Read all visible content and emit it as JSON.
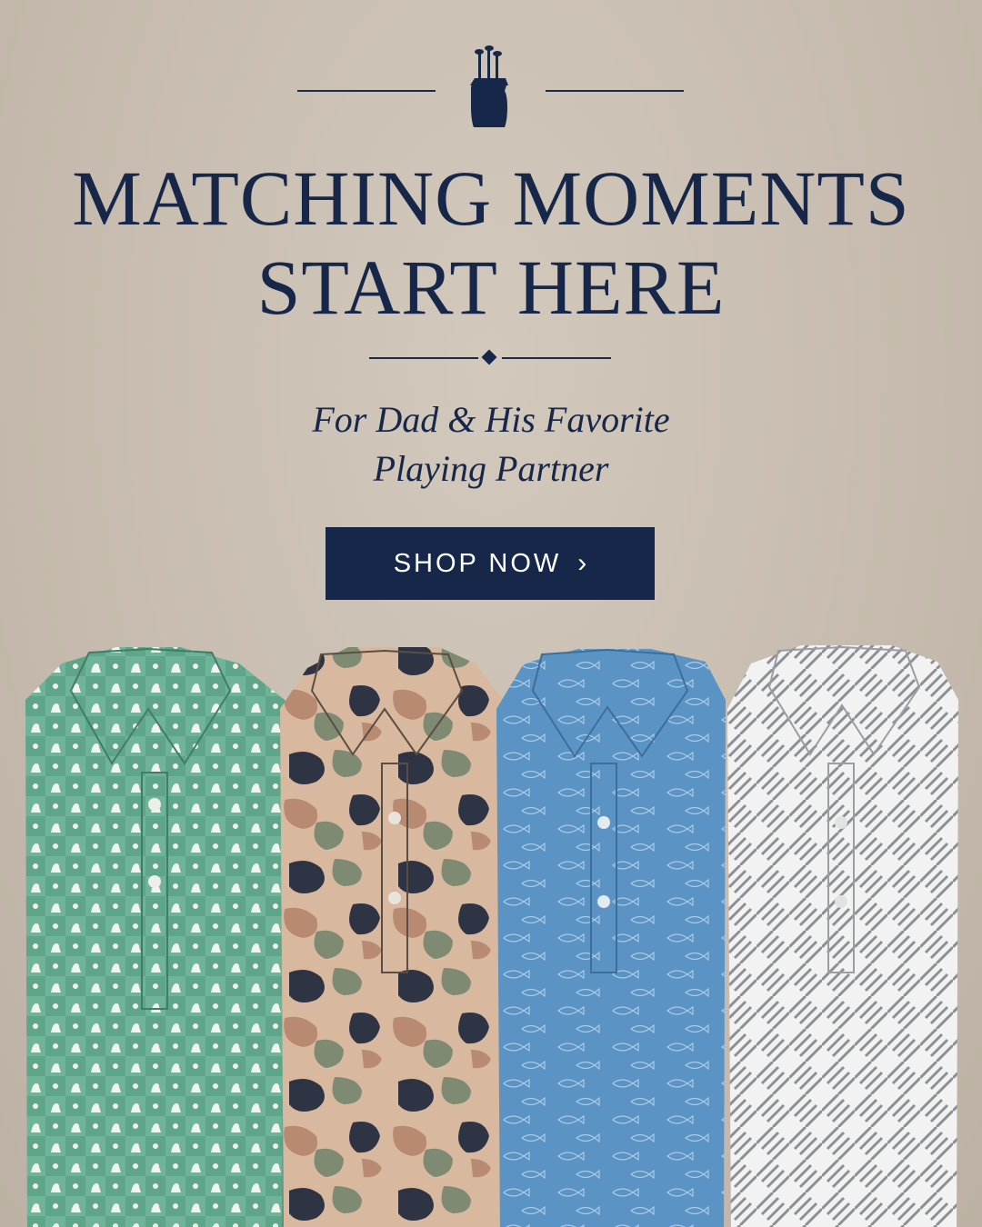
{
  "banner": {
    "headline_line1": "MATCHING MOMENTS",
    "headline_line2": "START HERE",
    "subheading_line1": "For Dad & His Favorite",
    "subheading_line2": "Playing Partner",
    "cta_label": "SHOP NOW",
    "cta_icon": "chevron-right-icon",
    "logo_icon": "golf-bag-icon"
  },
  "colors": {
    "navy": "#17274a",
    "background": "#c8bdb0"
  },
  "shirts": [
    {
      "pattern": "green-dog-checker",
      "color": "#5fa58a"
    },
    {
      "pattern": "camo",
      "color": "#c9a58a"
    },
    {
      "pattern": "blue-fish",
      "color": "#5b93c4"
    },
    {
      "pattern": "white-gray-herringbone",
      "color": "#f2f2f2"
    }
  ]
}
